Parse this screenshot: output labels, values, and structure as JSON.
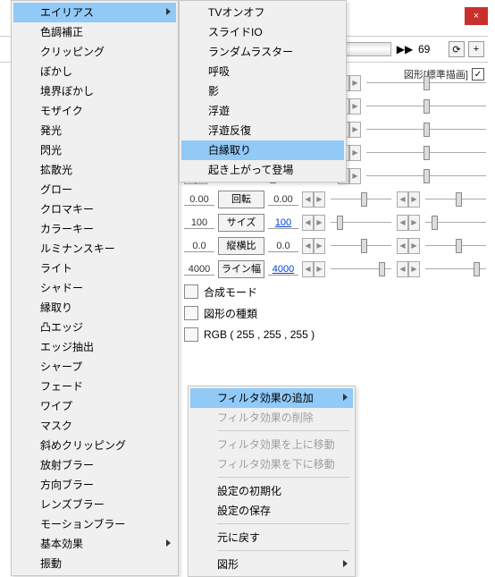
{
  "close_label": "×",
  "toolbar": {
    "jump_val": "69",
    "jump_icon": "▶▶",
    "btn_recycle": "⟳",
    "btn_plus": "+"
  },
  "subheader": {
    "shape_label": "図形[標準描画]",
    "checked": "✓"
  },
  "menu1": {
    "header": "エイリアス",
    "items": [
      "色調補正",
      "クリッピング",
      "ぼかし",
      "境界ぼかし",
      "モザイク",
      "発光",
      "閃光",
      "拡散光",
      "グロー",
      "クロマキー",
      "カラーキー",
      "ルミナンスキー",
      "ライト",
      "シャドー",
      "縁取り",
      "凸エッジ",
      "エッジ抽出",
      "シャープ",
      "フェード",
      "ワイプ",
      "マスク",
      "斜めクリッピング",
      "放射ブラー",
      "方向ブラー",
      "レンズブラー",
      "モーションブラー",
      "基本効果",
      "振動"
    ],
    "sub_at": 26
  },
  "menu2": {
    "items": [
      "TVオンオフ",
      "スライドIO",
      "ランダムラスター",
      "呼吸",
      "影",
      "浮遊",
      "浮遊反復",
      "白縁取り",
      "起き上がって登場"
    ],
    "highlight": 7
  },
  "params": [
    {
      "v1": "0.00",
      "btn": "回転",
      "v2": "0.00",
      "t1": 50,
      "t2": 50
    },
    {
      "v1": "100",
      "btn": "サイズ",
      "v2": "100",
      "t1": 10,
      "t2": 10,
      "link": true
    },
    {
      "v1": "0.0",
      "btn": "縦横比",
      "v2": "0.0",
      "t1": 50,
      "t2": 50
    },
    {
      "v1": "4000",
      "btn": "ライン幅",
      "v2": "4000",
      "t1": 80,
      "t2": 80,
      "link": true
    }
  ],
  "extra_sliders_count": 5,
  "static_rows": [
    "合成モード",
    "図形の種類",
    "RGB ( 255 , 255 , 255 )"
  ],
  "ctx": [
    {
      "t": "フィルタ効果の追加",
      "sub": true,
      "hi": true
    },
    {
      "t": "フィルタ効果の削除",
      "dis": true
    },
    {
      "sep": true
    },
    {
      "t": "フィルタ効果を上に移動",
      "dis": true
    },
    {
      "t": "フィルタ効果を下に移動",
      "dis": true
    },
    {
      "sep": true
    },
    {
      "t": "設定の初期化"
    },
    {
      "t": "設定の保存"
    },
    {
      "sep": true
    },
    {
      "t": "元に戻す"
    },
    {
      "sep": true
    },
    {
      "t": "図形",
      "sub": true
    }
  ]
}
